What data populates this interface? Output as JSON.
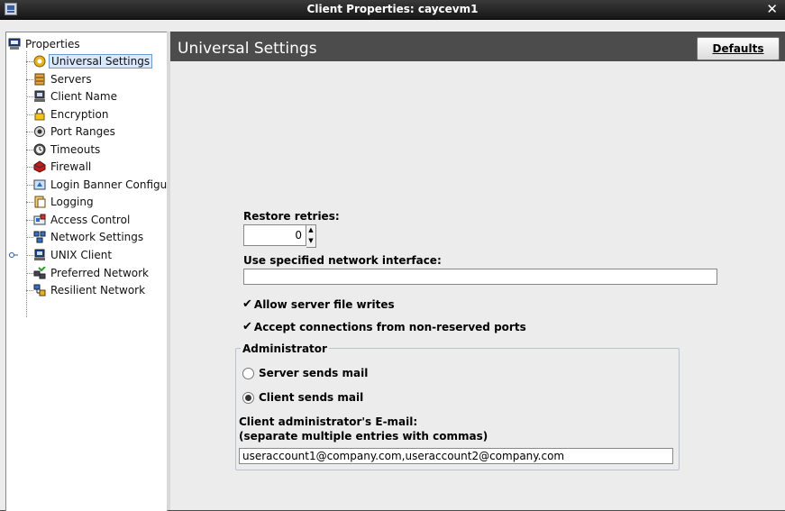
{
  "window": {
    "title": "Client Properties: caycevm1"
  },
  "tree": {
    "root_label": "Properties",
    "items": [
      {
        "label": "Universal Settings",
        "icon": "universal-settings-icon",
        "selected": true
      },
      {
        "label": "Servers",
        "icon": "servers-icon"
      },
      {
        "label": "Client Name",
        "icon": "client-name-icon"
      },
      {
        "label": "Encryption",
        "icon": "lock-icon"
      },
      {
        "label": "Port Ranges",
        "icon": "port-ranges-icon"
      },
      {
        "label": "Timeouts",
        "icon": "clock-icon"
      },
      {
        "label": "Firewall",
        "icon": "firewall-icon"
      },
      {
        "label": "Login Banner Configu",
        "icon": "login-banner-icon"
      },
      {
        "label": "Logging",
        "icon": "logging-icon"
      },
      {
        "label": "Access Control",
        "icon": "access-control-icon"
      },
      {
        "label": "Network Settings",
        "icon": "network-settings-icon"
      },
      {
        "label": "UNIX Client",
        "icon": "unix-client-icon",
        "expandable": true
      },
      {
        "label": "Preferred Network",
        "icon": "preferred-network-icon"
      },
      {
        "label": "Resilient Network",
        "icon": "resilient-network-icon"
      }
    ]
  },
  "panel": {
    "title": "Universal Settings",
    "defaults_label": "Defaults",
    "restore_retries_label": "Restore retries:",
    "restore_retries_value": "0",
    "network_interface_label": "Use specified network interface:",
    "network_interface_value": "",
    "allow_writes_label": "Allow server file writes",
    "allow_writes_checked": true,
    "accept_connections_label": "Accept connections from non-reserved ports",
    "accept_connections_checked": true,
    "administrator": {
      "legend": "Administrator",
      "server_sends_label": "Server sends mail",
      "client_sends_label": "Client sends mail",
      "selected": "client",
      "email_label_line1": "Client administrator's E-mail:",
      "email_label_line2": "(separate multiple entries with commas)",
      "email_value": "useraccount1@company.com,useraccount2@company.com"
    }
  }
}
